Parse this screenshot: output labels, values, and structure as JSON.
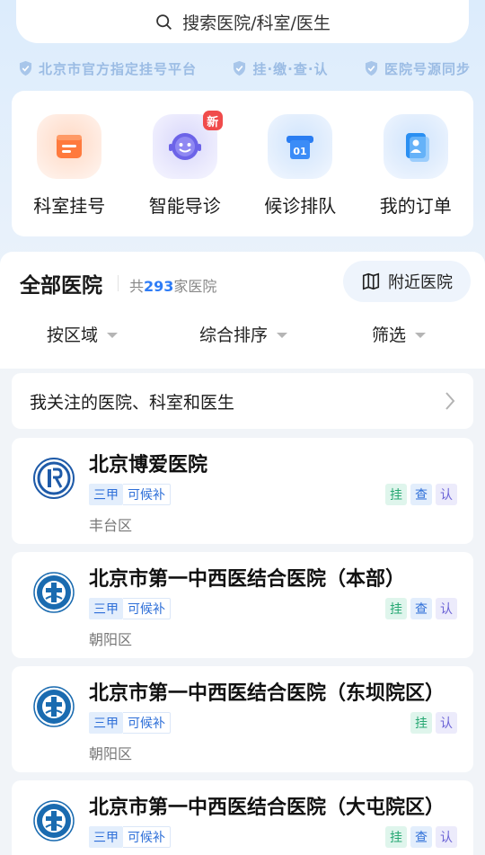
{
  "search": {
    "placeholder": "搜索医院/科室/医生"
  },
  "trust": [
    {
      "label": "北京市官方指定挂号平台"
    },
    {
      "label": "挂·缴·查·认"
    },
    {
      "label": "医院号源同步"
    }
  ],
  "quick_actions": [
    {
      "label": "科室挂号",
      "icon": "department-register-icon",
      "badge": ""
    },
    {
      "label": "智能导诊",
      "icon": "smart-guide-robot-icon",
      "badge": "新"
    },
    {
      "label": "候诊排队",
      "icon": "queue-ticket-icon",
      "badge": ""
    },
    {
      "label": "我的订单",
      "icon": "my-orders-icon",
      "badge": ""
    }
  ],
  "hospital_section": {
    "title": "全部医院",
    "count_prefix": "共",
    "count": "293",
    "count_suffix": "家医院",
    "nearby_label": "附近医院",
    "filters": [
      {
        "label": "按区域"
      },
      {
        "label": "综合排序"
      },
      {
        "label": "筛选"
      }
    ]
  },
  "follow": {
    "label": "我关注的医院、科室和医生"
  },
  "hospitals": [
    {
      "name": "北京博爱医院",
      "level": "三甲",
      "tag": "可候补",
      "district": "丰台区",
      "services": [
        "挂",
        "查",
        "认"
      ],
      "logo": "boai-hospital-logo"
    },
    {
      "name": "北京市第一中西医结合医院（本部）",
      "level": "三甲",
      "tag": "可候补",
      "district": "朝阳区",
      "services": [
        "挂",
        "查",
        "认"
      ],
      "logo": "tcm-hospital-logo"
    },
    {
      "name": "北京市第一中西医结合医院（东坝院区）",
      "level": "三甲",
      "tag": "可候补",
      "district": "朝阳区",
      "services": [
        "挂",
        "认"
      ],
      "logo": "tcm-hospital-logo"
    },
    {
      "name": "北京市第一中西医结合医院（大屯院区）",
      "level": "三甲",
      "tag": "可候补",
      "district": "",
      "services": [
        "挂",
        "查",
        "认"
      ],
      "logo": "tcm-hospital-logo"
    }
  ],
  "colors": {
    "accent": "#2e7cf6",
    "register_service": "#27a873",
    "check_service": "#2e6fd8",
    "auth_service": "#6b63d6",
    "new_badge": "#f04b4b"
  }
}
